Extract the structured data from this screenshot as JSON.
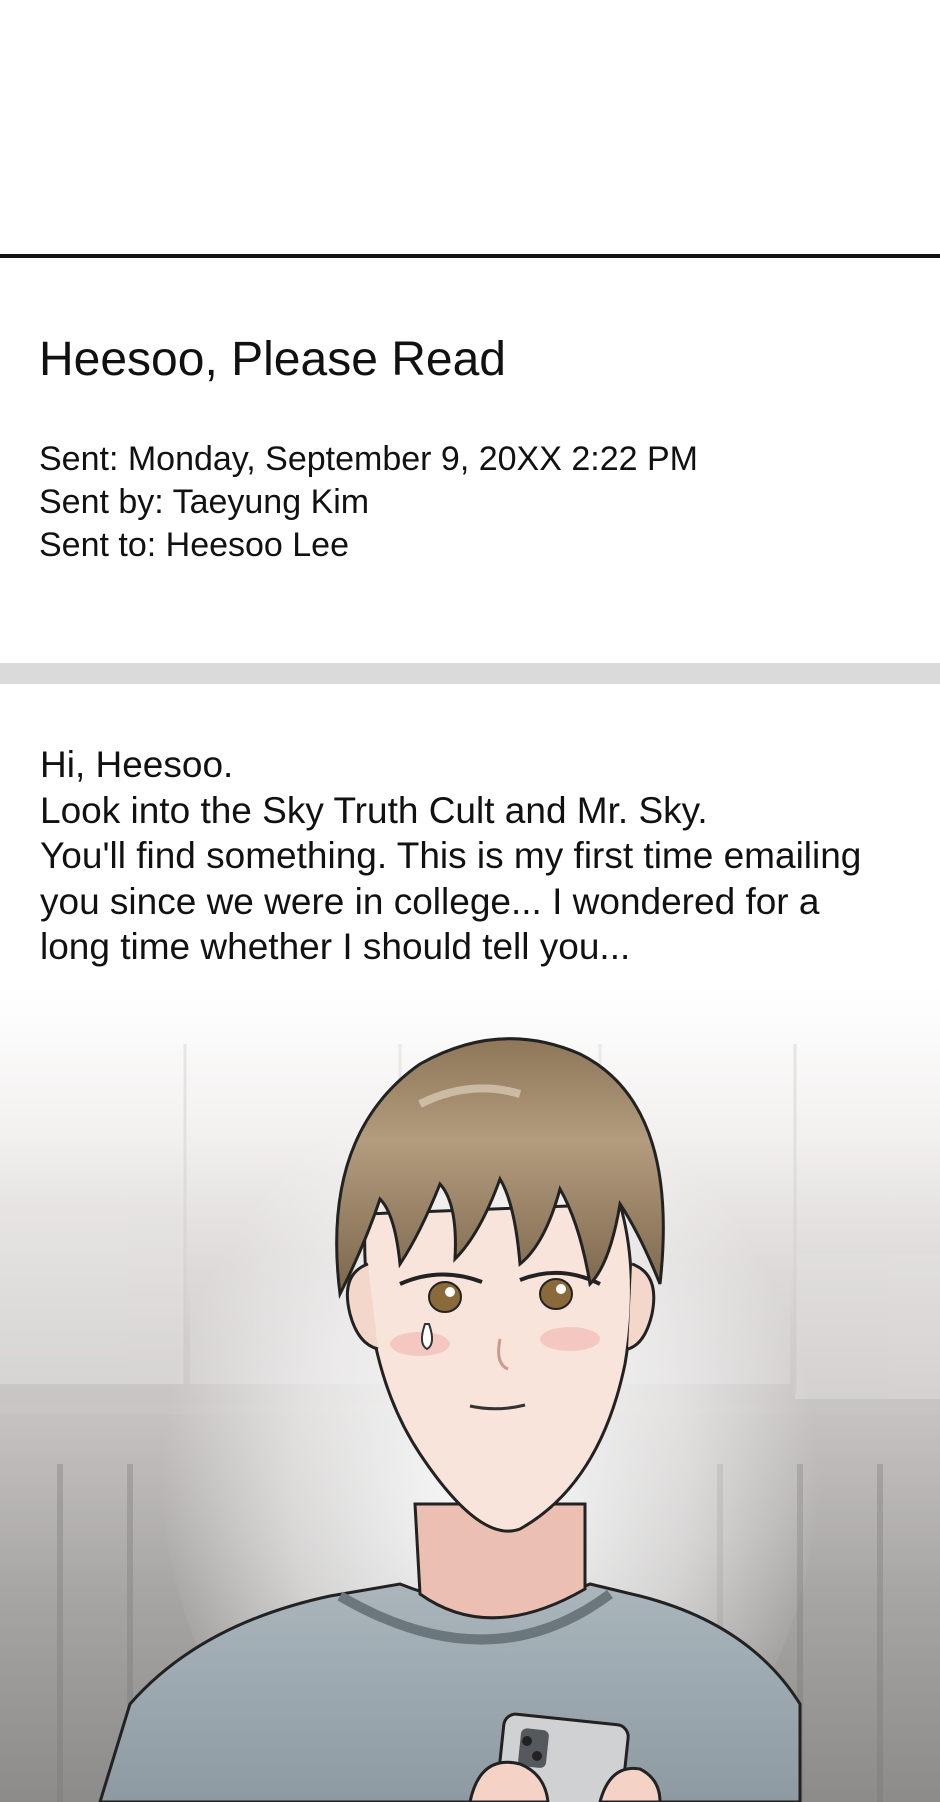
{
  "email": {
    "subject": "Heesoo, Please Read",
    "sent": "Sent: Monday, September 9, 20XX 2:22 PM",
    "sent_by": "Sent by: Taeyung Kim",
    "sent_to": "Sent to: Heesoo Lee",
    "body_lines": [
      "Hi, Heesoo.",
      "Look into the Sky Truth Cult and Mr. Sky.",
      "You'll find something. This is my first time emailing",
      "you since we were in college... I wondered for a",
      "long time whether I should tell you..."
    ]
  },
  "illustration": {
    "subject": "young man with brown hair looking down at a smartphone",
    "colors": {
      "hair": "#9a8266",
      "skin": "#f7e1d6",
      "shirt": "#9eaab2",
      "eyes": "#8a6a3a",
      "background": "#8d8b89"
    }
  }
}
